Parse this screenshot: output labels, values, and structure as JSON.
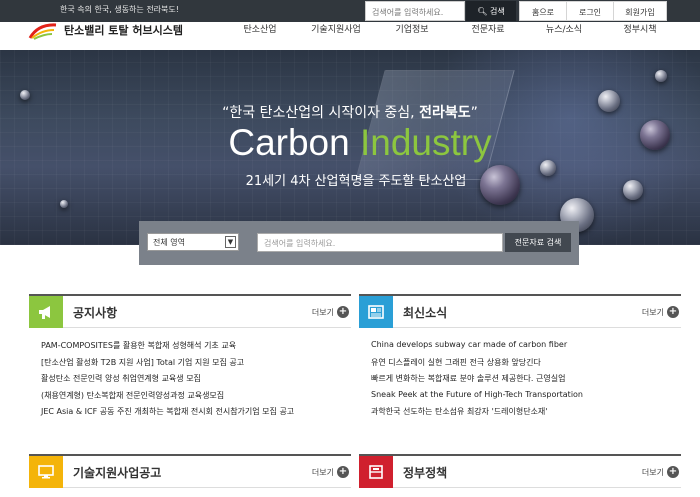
{
  "topbar": {
    "tagline": "한국 속의 한국, 생동하는 전라북도!",
    "search_placeholder": "검색어를 입력하세요.",
    "search_button": "검색",
    "links": [
      "홈으로",
      "로그인",
      "회원가입"
    ]
  },
  "header": {
    "logo_text": "탄소밸리 토탈 허브시스템",
    "nav": [
      "탄소산업",
      "기술지원사업",
      "기업정보",
      "전문자료",
      "뉴스/소식",
      "정부시책"
    ]
  },
  "hero": {
    "quote_prefix": "“한국 탄소산업의 시작이자 중심, ",
    "quote_bold": "전라북도",
    "quote_suffix": "”",
    "title_white": "Carbon ",
    "title_green": "Industry",
    "subtitle": "21세기 4차 산업혁명을 주도할 탄소산업"
  },
  "search": {
    "select_value": "전체 영역",
    "placeholder": "검색어를 입력하세요.",
    "button": "전문자료 검색"
  },
  "boards": {
    "notice": {
      "title": "공지사항",
      "more": "더보기",
      "items": [
        "PAM-COMPOSITES를 활용한 복합재 성형해석 기초 교육",
        "[탄소산업 활성화 T2B 지원 사업] Total 기업 지원 모집 공고",
        "활성탄소 전문인력 양성 취업연계형 교육생 모집",
        "(채용연계형) 탄소복합재 전문인력양성과정 교육생모집",
        "JEC Asia & ICF 공동 주진 개최하는 복합재 전시회 전시참가기업 모집 공고"
      ]
    },
    "news": {
      "title": "최신소식",
      "more": "더보기",
      "items": [
        "China develops subway car made of carbon fiber",
        "유연 디스플레이 실현 그래핀 전극 상용화 앞당긴다",
        "빠르게 변화하는 복합재료 분야 솔루션 제공한다. 근영실업",
        "Sneak Peek at the Future of High-Tech Transportation",
        "과학한국 선도하는 탄소섬유 최강자 '드레이형단소재'"
      ]
    },
    "support": {
      "title": "기술지원사업공고",
      "more": "더보기"
    },
    "policy": {
      "title": "정부정책",
      "more": "더보기"
    }
  },
  "colors": {
    "notice_accent": "#8cc63f",
    "news_accent": "#2a9fd6",
    "support_accent": "#f4b40a",
    "policy_accent": "#d0202e",
    "topbar": "#31373d"
  }
}
